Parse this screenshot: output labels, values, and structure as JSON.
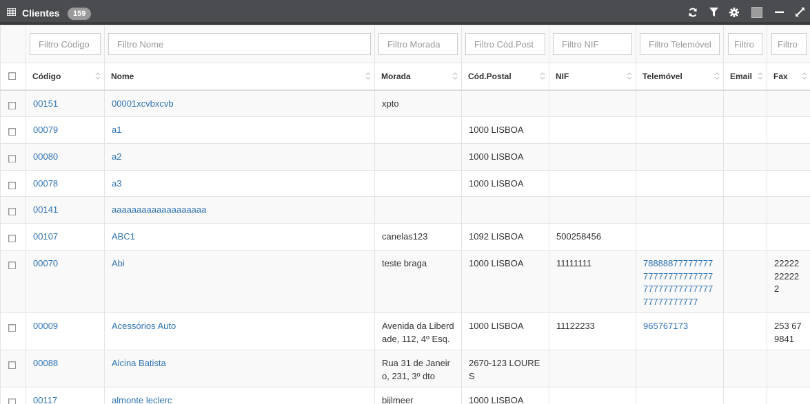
{
  "header": {
    "icon": "table-grid-icon",
    "title": "Clientes",
    "count": "159",
    "tools": [
      "refresh-icon",
      "filter-icon",
      "gear-icon",
      "square-icon",
      "minimize-icon",
      "expand-icon"
    ]
  },
  "filters": {
    "codigo": "Filtro Código",
    "nome": "Filtro Nome",
    "morada": "Filtro Morada",
    "cpostal": "Filtro Cód.Post",
    "nif": "Filtro NIF",
    "telemovel": "Filtro Telemóvel",
    "email": "Filtro Email",
    "fax": "Filtro Fax"
  },
  "columns": {
    "codigo": "Código",
    "nome": "Nome",
    "morada": "Morada",
    "cpostal": "Cód.Postal",
    "nif": "NIF",
    "telemovel": "Telemóvel",
    "email": "Email",
    "fax": "Fax"
  },
  "rows": [
    {
      "codigo": "00151",
      "nome": "00001xcvbxcvb",
      "morada": "xpto",
      "cpostal": "",
      "nif": "",
      "telemovel": "",
      "email": "",
      "fax": ""
    },
    {
      "codigo": "00079",
      "nome": "a1",
      "morada": "",
      "cpostal": "1000 LISBOA",
      "nif": "",
      "telemovel": "",
      "email": "",
      "fax": ""
    },
    {
      "codigo": "00080",
      "nome": "a2",
      "morada": "",
      "cpostal": "1000 LISBOA",
      "nif": "",
      "telemovel": "",
      "email": "",
      "fax": ""
    },
    {
      "codigo": "00078",
      "nome": "a3",
      "morada": "",
      "cpostal": "1000 LISBOA",
      "nif": "",
      "telemovel": "",
      "email": "",
      "fax": ""
    },
    {
      "codigo": "00141",
      "nome": "aaaaaaaaaaaaaaaaaaa",
      "morada": "",
      "cpostal": "",
      "nif": "",
      "telemovel": "",
      "email": "",
      "fax": ""
    },
    {
      "codigo": "00107",
      "nome": "ABC1",
      "morada": "canelas123",
      "cpostal": "1092 LISBOA",
      "nif": "500258456",
      "telemovel": "",
      "email": "",
      "fax": ""
    },
    {
      "codigo": "00070",
      "nome": "Abi",
      "morada": "teste braga",
      "cpostal": "1000 LISBOA",
      "nif": "11111111",
      "telemovel": "78888877777777777777777777777777777777777777777777777",
      "email": "",
      "fax": "22222222222"
    },
    {
      "codigo": "00009",
      "nome": "Acessórios Auto",
      "morada": "Avenida da Liberdade, 112, 4º Esq.",
      "cpostal": "1000 LISBOA",
      "nif": "11122233",
      "telemovel": "965767173",
      "email": "",
      "fax": "253 679841"
    },
    {
      "codigo": "00088",
      "nome": "Alcina Batista",
      "morada": "Rua 31 de Janeiro, 231, 3º dto",
      "cpostal": "2670-123 LOURES",
      "nif": "",
      "telemovel": "",
      "email": "",
      "fax": ""
    },
    {
      "codigo": "00117",
      "nome": "almonte leclerc",
      "morada": "bijlmeer",
      "cpostal": "1000 LISBOA",
      "nif": "",
      "telemovel": "",
      "email": "",
      "fax": ""
    }
  ]
}
